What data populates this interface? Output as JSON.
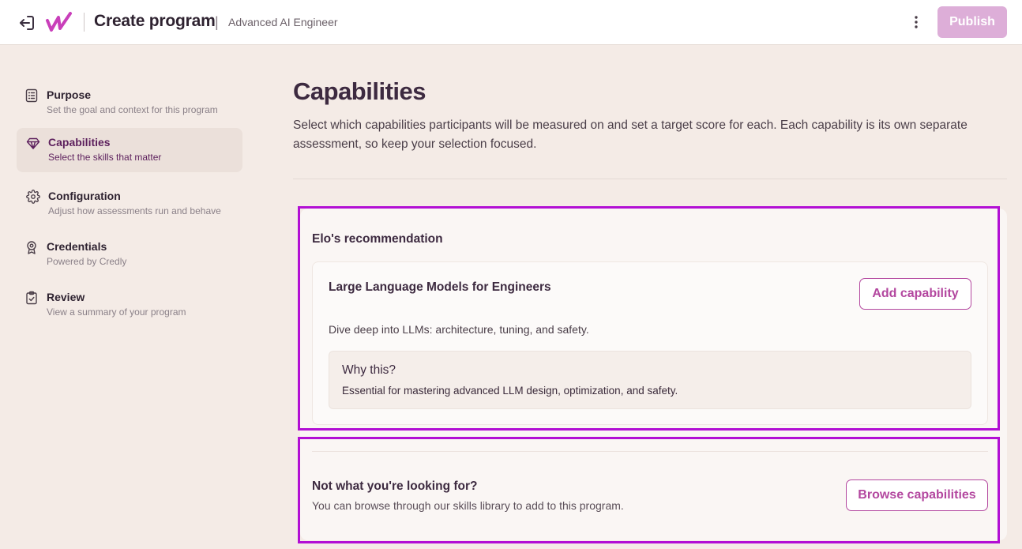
{
  "header": {
    "exit_icon": "exit-icon",
    "logo_icon": "wordmark-logo",
    "title": "Create program",
    "separator": "|",
    "program_name": "Advanced AI Engineer",
    "more_icon": "vertical-ellipsis-icon",
    "publish_label": "Publish",
    "publish_color": "#ddaed8"
  },
  "sidebar": {
    "items": [
      {
        "label": "Purpose",
        "description": "Set the goal and context for this program",
        "icon": "list-icon",
        "active": false
      },
      {
        "label": "Capabilities",
        "description": "Select the skills that matter",
        "icon": "gem-icon",
        "active": true
      },
      {
        "label": "Configuration",
        "description": "Adjust how assessments run and behave",
        "icon": "gear-icon",
        "active": false
      },
      {
        "label": "Credentials",
        "description": "Powered by Credly",
        "icon": "award-icon",
        "active": false
      },
      {
        "label": "Review",
        "description": "View a summary of your program",
        "icon": "clipboard-check-icon",
        "active": false
      }
    ]
  },
  "main": {
    "heading": "Capabilities",
    "description": "Select which capabilities participants will be measured on and set a target score for each. Each capability is its own separate assessment, so keep your selection focused.",
    "recommendation": {
      "title": "Elo's recommendation",
      "capability_name": "Large Language Models for Engineers",
      "capability_description": "Dive deep into LLMs: architecture, tuning, and safety.",
      "add_label": "Add capability",
      "why_title": "Why this?",
      "why_text": "Essential for mastering advanced LLM design, optimization, and safety."
    },
    "not_found": {
      "title": "Not what you're looking for?",
      "description": "You can browse through our skills library to add to this program.",
      "browse_label": "Browse capabilities"
    }
  },
  "colors": {
    "accent": "#b3479f",
    "active_text": "#5c1f5c",
    "highlight_outline": "#b20fd4",
    "background": "#f4ebe6"
  }
}
